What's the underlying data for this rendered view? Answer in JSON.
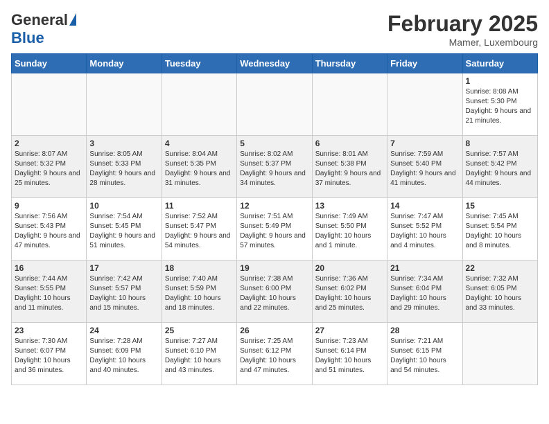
{
  "logo": {
    "general": "General",
    "blue": "Blue"
  },
  "title": "February 2025",
  "location": "Mamer, Luxembourg",
  "days_of_week": [
    "Sunday",
    "Monday",
    "Tuesday",
    "Wednesday",
    "Thursday",
    "Friday",
    "Saturday"
  ],
  "weeks": [
    [
      {
        "day": "",
        "info": ""
      },
      {
        "day": "",
        "info": ""
      },
      {
        "day": "",
        "info": ""
      },
      {
        "day": "",
        "info": ""
      },
      {
        "day": "",
        "info": ""
      },
      {
        "day": "",
        "info": ""
      },
      {
        "day": "1",
        "info": "Sunrise: 8:08 AM\nSunset: 5:30 PM\nDaylight: 9 hours and 21 minutes."
      }
    ],
    [
      {
        "day": "2",
        "info": "Sunrise: 8:07 AM\nSunset: 5:32 PM\nDaylight: 9 hours and 25 minutes."
      },
      {
        "day": "3",
        "info": "Sunrise: 8:05 AM\nSunset: 5:33 PM\nDaylight: 9 hours and 28 minutes."
      },
      {
        "day": "4",
        "info": "Sunrise: 8:04 AM\nSunset: 5:35 PM\nDaylight: 9 hours and 31 minutes."
      },
      {
        "day": "5",
        "info": "Sunrise: 8:02 AM\nSunset: 5:37 PM\nDaylight: 9 hours and 34 minutes."
      },
      {
        "day": "6",
        "info": "Sunrise: 8:01 AM\nSunset: 5:38 PM\nDaylight: 9 hours and 37 minutes."
      },
      {
        "day": "7",
        "info": "Sunrise: 7:59 AM\nSunset: 5:40 PM\nDaylight: 9 hours and 41 minutes."
      },
      {
        "day": "8",
        "info": "Sunrise: 7:57 AM\nSunset: 5:42 PM\nDaylight: 9 hours and 44 minutes."
      }
    ],
    [
      {
        "day": "9",
        "info": "Sunrise: 7:56 AM\nSunset: 5:43 PM\nDaylight: 9 hours and 47 minutes."
      },
      {
        "day": "10",
        "info": "Sunrise: 7:54 AM\nSunset: 5:45 PM\nDaylight: 9 hours and 51 minutes."
      },
      {
        "day": "11",
        "info": "Sunrise: 7:52 AM\nSunset: 5:47 PM\nDaylight: 9 hours and 54 minutes."
      },
      {
        "day": "12",
        "info": "Sunrise: 7:51 AM\nSunset: 5:49 PM\nDaylight: 9 hours and 57 minutes."
      },
      {
        "day": "13",
        "info": "Sunrise: 7:49 AM\nSunset: 5:50 PM\nDaylight: 10 hours and 1 minute."
      },
      {
        "day": "14",
        "info": "Sunrise: 7:47 AM\nSunset: 5:52 PM\nDaylight: 10 hours and 4 minutes."
      },
      {
        "day": "15",
        "info": "Sunrise: 7:45 AM\nSunset: 5:54 PM\nDaylight: 10 hours and 8 minutes."
      }
    ],
    [
      {
        "day": "16",
        "info": "Sunrise: 7:44 AM\nSunset: 5:55 PM\nDaylight: 10 hours and 11 minutes."
      },
      {
        "day": "17",
        "info": "Sunrise: 7:42 AM\nSunset: 5:57 PM\nDaylight: 10 hours and 15 minutes."
      },
      {
        "day": "18",
        "info": "Sunrise: 7:40 AM\nSunset: 5:59 PM\nDaylight: 10 hours and 18 minutes."
      },
      {
        "day": "19",
        "info": "Sunrise: 7:38 AM\nSunset: 6:00 PM\nDaylight: 10 hours and 22 minutes."
      },
      {
        "day": "20",
        "info": "Sunrise: 7:36 AM\nSunset: 6:02 PM\nDaylight: 10 hours and 25 minutes."
      },
      {
        "day": "21",
        "info": "Sunrise: 7:34 AM\nSunset: 6:04 PM\nDaylight: 10 hours and 29 minutes."
      },
      {
        "day": "22",
        "info": "Sunrise: 7:32 AM\nSunset: 6:05 PM\nDaylight: 10 hours and 33 minutes."
      }
    ],
    [
      {
        "day": "23",
        "info": "Sunrise: 7:30 AM\nSunset: 6:07 PM\nDaylight: 10 hours and 36 minutes."
      },
      {
        "day": "24",
        "info": "Sunrise: 7:28 AM\nSunset: 6:09 PM\nDaylight: 10 hours and 40 minutes."
      },
      {
        "day": "25",
        "info": "Sunrise: 7:27 AM\nSunset: 6:10 PM\nDaylight: 10 hours and 43 minutes."
      },
      {
        "day": "26",
        "info": "Sunrise: 7:25 AM\nSunset: 6:12 PM\nDaylight: 10 hours and 47 minutes."
      },
      {
        "day": "27",
        "info": "Sunrise: 7:23 AM\nSunset: 6:14 PM\nDaylight: 10 hours and 51 minutes."
      },
      {
        "day": "28",
        "info": "Sunrise: 7:21 AM\nSunset: 6:15 PM\nDaylight: 10 hours and 54 minutes."
      },
      {
        "day": "",
        "info": ""
      }
    ]
  ]
}
